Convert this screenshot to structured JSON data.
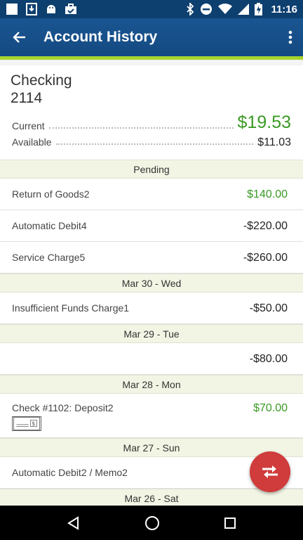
{
  "status_bar": {
    "time": "11:16",
    "left_icons": [
      "square-notification-icon",
      "download-notification-icon",
      "android-notification-icon",
      "briefcase-notification-icon"
    ],
    "right_icons": [
      "bluetooth-icon",
      "do-not-disturb-icon",
      "wifi-icon",
      "signal-icon",
      "battery-charging-icon"
    ]
  },
  "app_bar": {
    "title": "Account History",
    "accent_color": "#a7d52b",
    "bar_color": "#1a5591"
  },
  "account": {
    "name": "Checking",
    "number": "2114",
    "current_label": "Current",
    "current_value": "$19.53",
    "available_label": "Available",
    "available_value": "$11.03"
  },
  "sections": [
    {
      "header": "Pending",
      "rows": [
        {
          "description": "Return of Goods2",
          "amount": "$140.00",
          "positive": true
        },
        {
          "description": "Automatic Debit4",
          "amount": "-$220.00",
          "positive": false
        },
        {
          "description": "Service Charge5",
          "amount": "-$260.00",
          "positive": false
        }
      ]
    },
    {
      "header": "Mar 30 - Wed",
      "rows": [
        {
          "description": "Insufficient Funds Charge1",
          "amount": "-$50.00",
          "positive": false
        }
      ]
    },
    {
      "header": "Mar 29 - Tue",
      "rows": [
        {
          "description": "",
          "amount": "-$80.00",
          "positive": false
        }
      ]
    },
    {
      "header": "Mar 28 - Mon",
      "rows": [
        {
          "description": "Check #1102: Deposit2",
          "amount": "$70.00",
          "positive": true,
          "has_check_image": true
        }
      ]
    },
    {
      "header": "Mar 27 - Sun",
      "rows": [
        {
          "description": "Automatic Debit2 / Memo2",
          "amount": "-",
          "positive": false
        }
      ]
    },
    {
      "header": "Mar 26 - Sat",
      "rows": []
    }
  ],
  "fab": {
    "icon": "transfer-arrows-icon",
    "color": "#d03b3b"
  },
  "nav": {
    "icons": [
      "back-triangle-icon",
      "home-circle-icon",
      "recents-square-icon"
    ]
  }
}
